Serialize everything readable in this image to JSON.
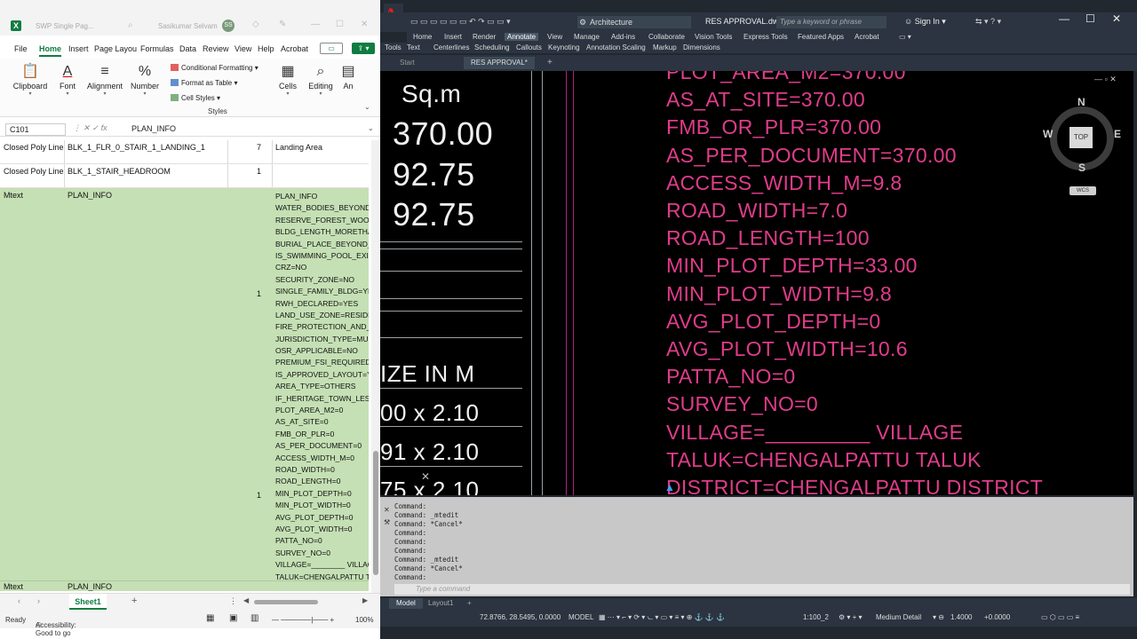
{
  "excel": {
    "doc_title": "SWP Single Pag...",
    "user_name": "Sasikumar Selvam",
    "user_initials": "SS",
    "menu": [
      "File",
      "Home",
      "Insert",
      "Page Layou",
      "Formulas",
      "Data",
      "Review",
      "View",
      "Help",
      "Acrobat"
    ],
    "active_menu": "Home",
    "ribbon": {
      "clipboard": "Clipboard",
      "font": "Font",
      "alignment": "Alignment",
      "number": "Number",
      "conditional": "Conditional Formatting",
      "format_table": "Format as Table",
      "cell_styles": "Cell Styles",
      "styles_group": "Styles",
      "cells": "Cells",
      "editing": "Editing",
      "analyze": "An"
    },
    "name_box": "C101",
    "formula": "PLAN_INFO",
    "rows": [
      {
        "a": "Closed Poly Line",
        "b": "BLK_1_FLR_0_STAIR_1_LANDING_1",
        "c": "7",
        "d": "Landing Area",
        "green": false
      },
      {
        "a": "Closed Poly Line",
        "b": "BLK_1_STAIR_HEADROOM",
        "c": "1",
        "d": "",
        "green": false
      }
    ],
    "mtext_a": "Mtext",
    "mtext_b": "PLAN_INFO",
    "mtext_count1": "1",
    "mtext_count2": "1",
    "mtext_lines": [
      "PLAN_INFO",
      "WATER_BODIES_BEYOND_",
      "RESERVE_FOREST_WOOD",
      "BLDG_LENGTH_MORETHA",
      "BURIAL_PLACE_BEYOND_",
      "IS_SWIMMING_POOL_EXI",
      "CRZ=NO",
      "SECURITY_ZONE=NO",
      "SINGLE_FAMILY_BLDG=YES",
      "RWH_DECLARED=YES",
      "LAND_USE_ZONE=RESIDE",
      "FIRE_PROTECTION_AND_",
      "JURISDICTION_TYPE=MUN",
      "OSR_APPLICABLE=NO",
      "PREMIUM_FSI_REQUIRED=",
      "IS_APPROVED_LAYOUT=YE",
      "AREA_TYPE=OTHERS",
      "IF_HERITAGE_TOWN_LESS",
      "PLOT_AREA_M2=0",
      "AS_AT_SITE=0",
      "FMB_OR_PLR=0",
      "AS_PER_DOCUMENT=0",
      "ACCESS_WIDTH_M=0",
      "ROAD_WIDTH=0",
      "ROAD_LENGTH=0",
      "MIN_PLOT_DEPTH=0",
      "MIN_PLOT_WIDTH=0",
      "AVG_PLOT_DEPTH=0",
      "AVG_PLOT_WIDTH=0",
      "PATTA_NO=0",
      "SURVEY_NO=0",
      "VILLAGE=________ VILLAG",
      "TALUK=CHENGALPATTU T",
      "DISTRICT=CHENGALPATTU"
    ],
    "last_row": {
      "a": "Mtext",
      "b": "PLAN_INFO"
    },
    "sheet_tab": "Sheet1",
    "status_ready": "Ready",
    "status_access": "Accessibility: Good to go",
    "zoom": "100%"
  },
  "acad": {
    "logo": "A",
    "workspace": "Architecture",
    "doc_title": "RES APPROVAL.dwg",
    "search_placeholder": "Type a keyword or phrase",
    "sign_in": "Sign In",
    "tabs1": [
      "Home",
      "Insert",
      "Render",
      "Annotate",
      "View",
      "Manage",
      "Add-ins",
      "Collaborate",
      "Vision Tools",
      "Express Tools",
      "Featured Apps",
      "Acrobat"
    ],
    "active_tab": "Annotate",
    "tabs2": [
      "Tools",
      "Text",
      "Centerlines",
      "Scheduling",
      "Callouts",
      "Keynoting",
      "Annotation Scaling",
      "Markup",
      "Dimensions"
    ],
    "file_tabs": [
      "Start",
      "RES APPROVAL*"
    ],
    "canvas_white": [
      "Sq.m",
      "370.00",
      "92.75",
      "92.75",
      "IZE IN M",
      "00 x 2.10",
      "91 x 2.10",
      "75 x 2.10"
    ],
    "canvas_pink": [
      "PLOT_AREA_M2=370.00",
      "AS_AT_SITE=370.00",
      "FMB_OR_PLR=370.00",
      "AS_PER_DOCUMENT=370.00",
      "ACCESS_WIDTH_M=9.8",
      "ROAD_WIDTH=7.0",
      "ROAD_LENGTH=100",
      "MIN_PLOT_DEPTH=33.00",
      "MIN_PLOT_WIDTH=9.8",
      "AVG_PLOT_DEPTH=0",
      "AVG_PLOT_WIDTH=10.6",
      "PATTA_NO=0",
      "SURVEY_NO=0",
      "VILLAGE=_________ VILLAGE",
      "TALUK=CHENGALPATTU TALUK",
      "DISTRICT=CHENGALPATTU DISTRICT"
    ],
    "viewcube": {
      "top": "TOP",
      "n": "N",
      "s": "S",
      "e": "E",
      "w": "W",
      "wcs": "WCS"
    },
    "command_history": [
      "Command:",
      "Command: _mtedit",
      "Command: *Cancel*",
      "Command:",
      "Command:",
      "Command:",
      "Command: _mtedit",
      "Command: *Cancel*",
      "Command:"
    ],
    "command_placeholder": "Type a command",
    "layout_tabs": [
      "Model",
      "Layout1"
    ],
    "coords": "72.8766, 28.5495, 0.0000",
    "model": "MODEL",
    "scale": "1:100_2",
    "detail": "Medium Detail",
    "elev": "1.4000",
    "offset": "+0.0000"
  }
}
